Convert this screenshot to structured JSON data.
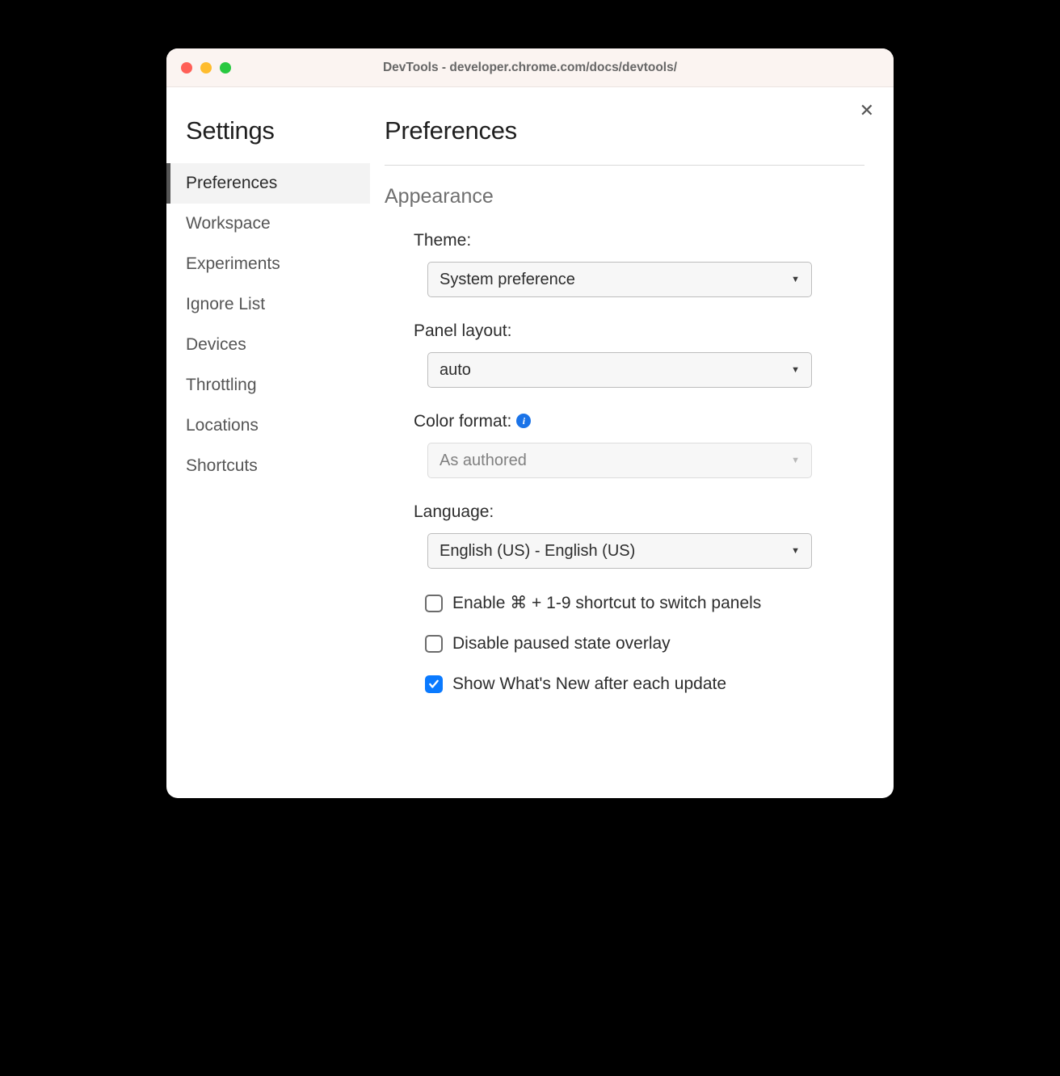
{
  "window": {
    "title": "DevTools - developer.chrome.com/docs/devtools/"
  },
  "settings": {
    "title": "Settings",
    "sidebar": [
      {
        "label": "Preferences",
        "active": true
      },
      {
        "label": "Workspace",
        "active": false
      },
      {
        "label": "Experiments",
        "active": false
      },
      {
        "label": "Ignore List",
        "active": false
      },
      {
        "label": "Devices",
        "active": false
      },
      {
        "label": "Throttling",
        "active": false
      },
      {
        "label": "Locations",
        "active": false
      },
      {
        "label": "Shortcuts",
        "active": false
      }
    ]
  },
  "content": {
    "title": "Preferences",
    "section_label": "Appearance",
    "theme": {
      "label": "Theme:",
      "value": "System preference"
    },
    "panel_layout": {
      "label": "Panel layout:",
      "value": "auto"
    },
    "color_format": {
      "label": "Color format:",
      "value": "As authored",
      "disabled": true
    },
    "language": {
      "label": "Language:",
      "value": "English (US) - English (US)"
    },
    "checkboxes": [
      {
        "label": "Enable ⌘ + 1-9 shortcut to switch panels",
        "checked": false
      },
      {
        "label": "Disable paused state overlay",
        "checked": false
      },
      {
        "label": "Show What's New after each update",
        "checked": true
      }
    ]
  }
}
